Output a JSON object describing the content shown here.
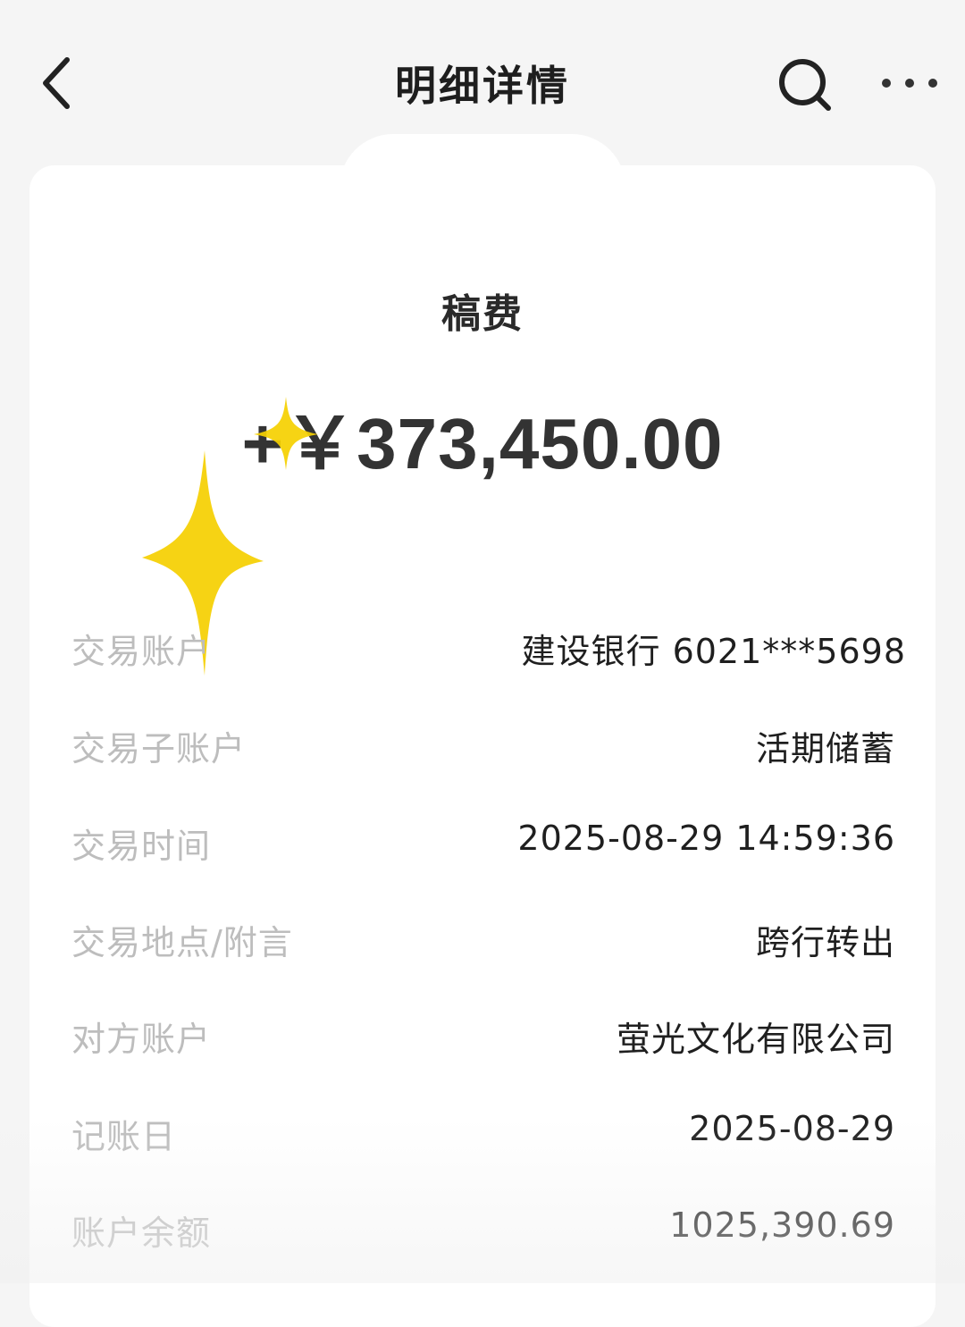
{
  "header": {
    "title": "明细详情",
    "back_icon": "chevron-left-icon",
    "search_icon": "search-icon",
    "more_icon": "more-horizontal-icon"
  },
  "transaction": {
    "title": "稿费",
    "amount": "+￥373,450.00"
  },
  "details": [
    {
      "label": "交易账户",
      "value": "建设银行 6021***5698"
    },
    {
      "label": "交易子账户",
      "value": "活期储蓄"
    },
    {
      "label": "交易时间",
      "value": "2025-08-29 14:59:36"
    },
    {
      "label": "交易地点/附言",
      "value": "跨行转出"
    },
    {
      "label": "对方账户",
      "value": "萤光文化有限公司"
    },
    {
      "label": "记账日",
      "value": "2025-08-29"
    },
    {
      "label": "账户余额",
      "value": "1025,390.69"
    }
  ],
  "colors": {
    "background": "#f5f5f5",
    "card": "#ffffff",
    "label": "#bdbdbd",
    "value": "#1f1f1f",
    "sparkle": "#f5d000"
  }
}
